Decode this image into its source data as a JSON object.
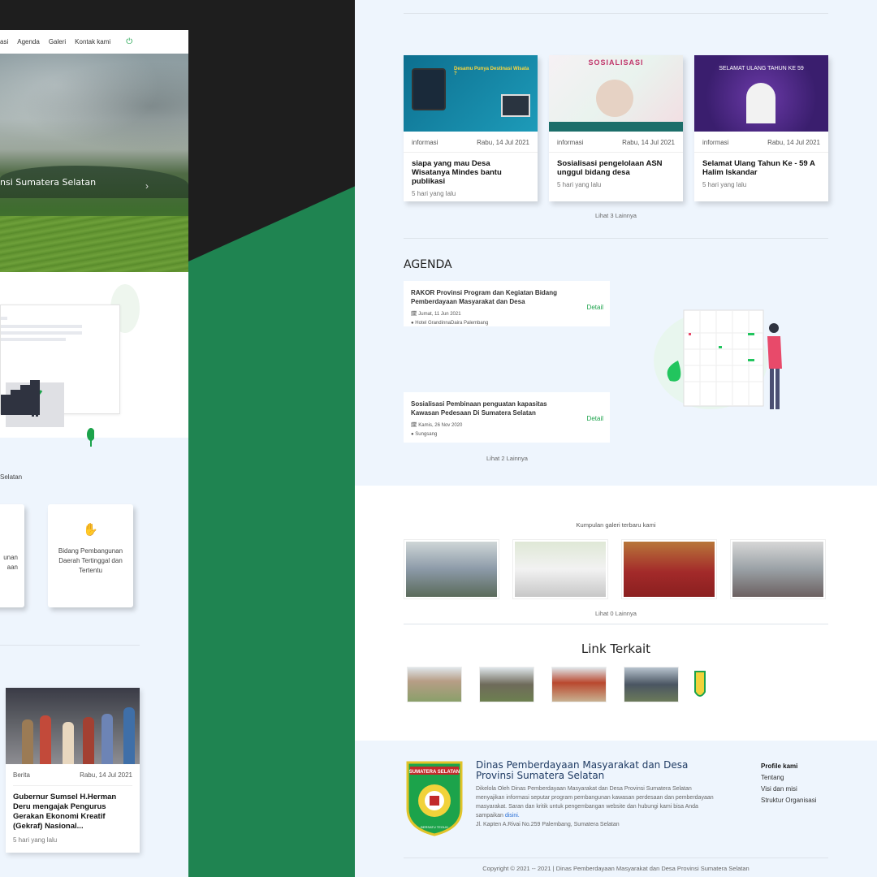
{
  "left_page": {
    "nav": [
      "asi",
      "Agenda",
      "Galeri",
      "Kontak kami"
    ],
    "power_icon": "power-icon",
    "hero_caption": "nsi Sumatera Selatan",
    "breadcrumb": "Selatan",
    "cards": [
      {
        "text": "unan\naan"
      },
      {
        "icon": "hand-leaf-icon",
        "text": "Bidang Pembangunan Daerah Tertinggal dan Tertentu"
      }
    ],
    "news": {
      "category": "Berita",
      "date": "Rabu, 14 Jul 2021",
      "title": "Gubernur Sumsel H.Herman Deru mengajak Pengurus Gerakan Ekonomi Kreatif (Gekraf) Nasional...",
      "ago": "5 hari yang lalu"
    }
  },
  "right_page": {
    "info_cards": [
      {
        "category": "informasi",
        "date": "Rabu, 14 Jul 2021",
        "title": "siapa yang mau Desa Wisatanya Mindes bantu publikasi",
        "ago": "5 hari yang lalu",
        "img_text": "Desamu Punya Destinasi Wisata ?"
      },
      {
        "category": "informasi",
        "date": "Rabu, 14 Jul 2021",
        "title": "Sosialisasi pengelolaan ASN unggul bidang desa",
        "ago": "5 hari yang lalu",
        "img_text": "SOSIALISASI"
      },
      {
        "category": "informasi",
        "date": "Rabu, 14 Jul 2021",
        "title": "Selamat Ulang Tahun Ke - 59 A Halim Iskandar",
        "ago": "5 hari yang lalu",
        "img_text": "SELAMAT ULANG TAHUN KE 59"
      }
    ],
    "info_more": "Lihat 3 Lainnya",
    "agenda_heading": "AGENDA",
    "agenda": [
      {
        "title": "RAKOR Provinsi Program dan Kegiatan Bidang Pemberdayaan Masyarakat dan Desa",
        "date": "Jumat, 11 Jun 2021",
        "place": "Hotel GrandinnaDaira Palembang",
        "detail": "Detail"
      },
      {
        "title": "Sosialisasi Pembinaan penguatan kapasitas Kawasan Pedesaan Di Sumatera Selatan",
        "date": "Kamis, 26 Nov 2020",
        "place": "Sungsang",
        "detail": "Detail"
      }
    ],
    "agenda_more": "Lihat 2 Lainnya",
    "gallery_sub": "Kumpulan galeri terbaru kami",
    "gallery_more": "Lihat 0 Lainnya",
    "link_heading": "Link Terkait",
    "footer": {
      "title": "Dinas Pemberdayaan Masyarakat dan Desa Provinsi Sumatera Selatan",
      "desc": "Dikelola Oleh Dinas Pemberdayaan Masyarakat dan Desa Provinsi Sumatera Selatan menyajikan informasi seputar program pembangunan kawasan perdesaan dan pemberdayaan masyarakat. Saran dan kritik untuk pengembangan website dan hubungi kami bisa Anda sampaikan",
      "desc_link": "disini.",
      "address": "Jl. Kapten A.Rivai No.259 Palembang, Sumatera Selatan",
      "links_heading": "Profile kami",
      "links": [
        "Tentang",
        "Visi dan misi",
        "Struktur Organisasi"
      ],
      "logo_text": "SUMATERA SELATAN",
      "logo_motto": "BERSATU TEGUH",
      "copyright": "Copyright © 2021 -- 2021 | Dinas Pemberdayaan Masyarakat dan Desa Provinsi Sumatera Selatan"
    }
  },
  "colors": {
    "accent_green": "#1ca34b",
    "band_green": "#1f8451",
    "dark_bg": "#1e1e1e",
    "page_bg": "#eef5fd"
  }
}
